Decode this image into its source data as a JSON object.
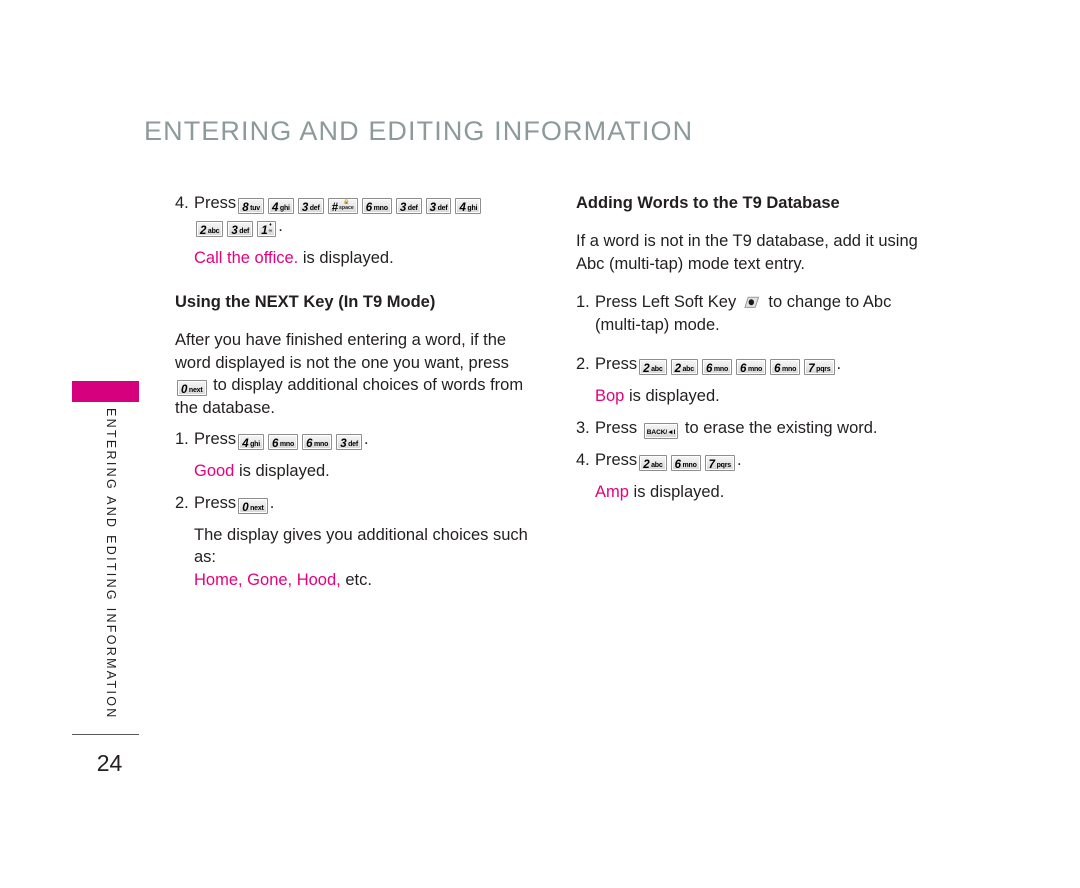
{
  "header": {
    "title": "ENTERING AND EDITING INFORMATION"
  },
  "sidebar": {
    "vertical_label": "ENTERING AND EDITING INFORMATION",
    "tab_color": "#d6007f",
    "page_number": "24"
  },
  "colors": {
    "header_gray": "#8c9a9b",
    "accent_pink": "#e5007d",
    "body_text": "#231f20"
  },
  "left_column": {
    "step4": {
      "num": "4.",
      "press": "Press",
      "keys_row1": [
        {
          "big": "8",
          "sm": "tuv"
        },
        {
          "big": "4",
          "sm": "ghi"
        },
        {
          "big": "3",
          "sm": "def"
        },
        {
          "big": "#",
          "sm": "space",
          "lock": true
        },
        {
          "big": "6",
          "sm": "mno"
        },
        {
          "big": "3",
          "sm": "def"
        },
        {
          "big": "3",
          "sm": "def"
        },
        {
          "big": "4",
          "sm": "ghi"
        }
      ],
      "keys_row2": [
        {
          "big": "2",
          "sm": "abc"
        },
        {
          "big": "3",
          "sm": "def"
        },
        {
          "big": "1",
          "sm": "voicemail",
          "voicemail": true
        }
      ],
      "period": "."
    },
    "result1": {
      "sample": "Call the office.",
      "suffix": " is displayed."
    },
    "subheading": "Using the NEXT Key (In T9 Mode)",
    "paragraph_part1": "After you have finished entering a word, if the word displayed is not the one you want, press ",
    "paragraph_key": {
      "big": "0",
      "sm": "next"
    },
    "paragraph_part2": " to display additional choices of words from the database.",
    "step1": {
      "num": "1.",
      "press": "Press",
      "keys": [
        {
          "big": "4",
          "sm": "ghi"
        },
        {
          "big": "6",
          "sm": "mno"
        },
        {
          "big": "6",
          "sm": "mno"
        },
        {
          "big": "3",
          "sm": "def"
        }
      ],
      "period": "."
    },
    "result2": {
      "sample": "Good",
      "suffix": " is displayed."
    },
    "step2": {
      "num": "2.",
      "press": "Press",
      "keys": [
        {
          "big": "0",
          "sm": "next"
        }
      ],
      "period": "."
    },
    "result3_line1": "The display gives you additional choices such as:",
    "result3_sample": "Home, Gone, Hood,",
    "result3_suffix": " etc."
  },
  "right_column": {
    "subheading": "Adding Words to the T9 Database",
    "intro": "If a word is not in the T9 database, add it using Abc (multi-tap) mode text entry.",
    "step1": {
      "num": "1.",
      "text_before": "Press Left Soft Key ",
      "icon": "left-soft-key-icon",
      "text_after": " to change to Abc (multi-tap) mode."
    },
    "step2": {
      "num": "2.",
      "press": "Press",
      "keys": [
        {
          "big": "2",
          "sm": "abc"
        },
        {
          "big": "2",
          "sm": "abc"
        },
        {
          "big": "6",
          "sm": "mno"
        },
        {
          "big": "6",
          "sm": "mno"
        },
        {
          "big": "6",
          "sm": "mno"
        },
        {
          "big": "7",
          "sm": "pqrs"
        }
      ],
      "period": "."
    },
    "result1": {
      "sample": "Bop",
      "suffix": " is displayed."
    },
    "step3": {
      "num": "3.",
      "text_before": "Press ",
      "key_label": "BACK/◄I",
      "text_after": " to erase the existing word."
    },
    "step4": {
      "num": "4.",
      "press": "Press",
      "keys": [
        {
          "big": "2",
          "sm": "abc"
        },
        {
          "big": "6",
          "sm": "mno"
        },
        {
          "big": "7",
          "sm": "pqrs"
        }
      ],
      "period": "."
    },
    "result2": {
      "sample": "Amp",
      "suffix": " is displayed."
    }
  }
}
